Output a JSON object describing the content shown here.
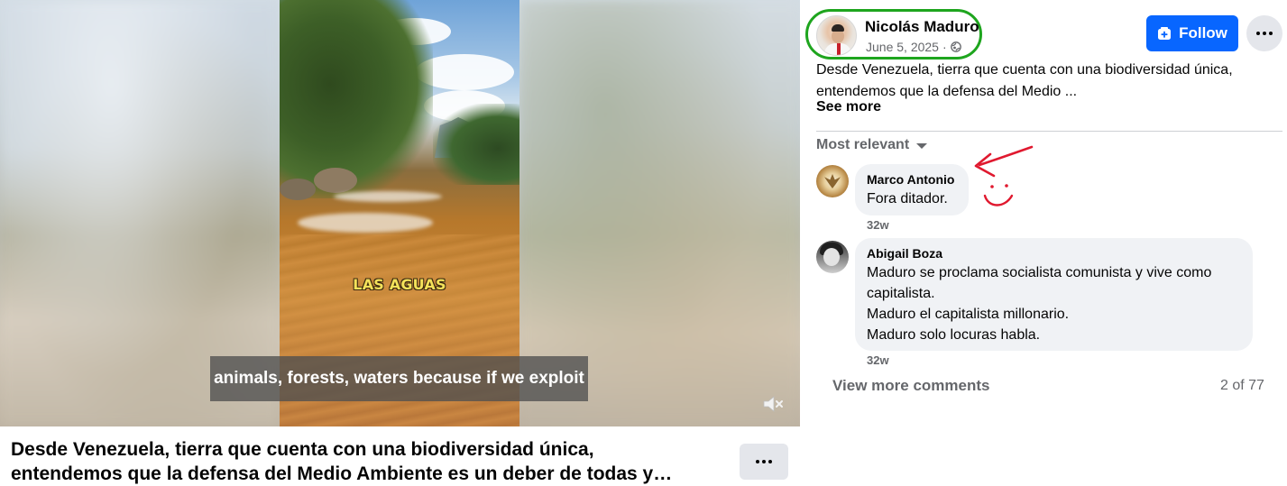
{
  "video": {
    "overlay_text": "LAS AGUAS",
    "caption": "animals, forests, waters because if we exploit",
    "mute_icon": "speaker-muted-icon"
  },
  "bottom": {
    "title_line1": "Desde Venezuela, tierra que cuenta con una biodiversidad única,",
    "title_line2": "entendemos que la defensa del Medio Ambiente es un deber de todas y…"
  },
  "post": {
    "author": "Nicolás Maduro",
    "date": "June 5, 2025",
    "separator": "·",
    "privacy_icon": "globe-icon",
    "follow_label": "Follow",
    "text_line1": "Desde Venezuela, tierra que cuenta con una biodiversidad única,",
    "text_line2": "entendemos que la defensa del Medio ...",
    "see_more": "See more",
    "sort_label": "Most relevant",
    "colors": {
      "accent": "#0866ff",
      "highlight": "#1ea51e",
      "annotation": "#e0192f"
    }
  },
  "comments": [
    {
      "name": "Marco Antonio",
      "lines": [
        "Fora ditador."
      ],
      "time": "32w"
    },
    {
      "name": "Abigail Boza",
      "lines": [
        "Maduro se proclama socialista comunista y vive como",
        "capitalista.",
        "Maduro el capitalista millonario.",
        "Maduro solo locuras habla."
      ],
      "time": "32w"
    }
  ],
  "footer": {
    "view_more": "View more comments",
    "count": "2 of 77"
  }
}
